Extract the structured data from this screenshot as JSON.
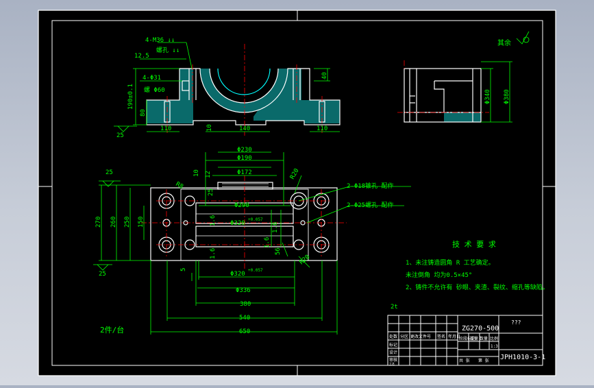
{
  "colors": {
    "outline": "#ffffff",
    "dimension": "#00ff00",
    "centerline": "#ff0000",
    "hatch": "#00ffff",
    "section": "#00ffff",
    "background": "#000000"
  },
  "top_view": {
    "callouts": [
      "4-M36 ↓↓",
      "螺孔 ↓↓",
      "4-Φ31",
      "螺 Φ60"
    ],
    "dims": {
      "d125": "12.5",
      "d190": "190±0.1",
      "d80": "80",
      "d40": "40",
      "d110_left": "110",
      "d10": "10",
      "d140": "140",
      "d110_right": "110",
      "rough25": "25"
    }
  },
  "side_view": {
    "dims": {
      "phi340": "Φ340",
      "phi380": "Φ380"
    },
    "finish_note": "其余"
  },
  "plan_view": {
    "dims": {
      "phi230": "Φ230",
      "phi190": "Φ190",
      "phi172": "Φ172",
      "d270": "270",
      "d260": "260",
      "d250": "250",
      "d150": "150",
      "d10": "10",
      "d12": "12",
      "d25": "25",
      "r20": "R20",
      "r8": "R8",
      "phi290": "Φ290",
      "phi320a": "Φ320",
      "tol_a": "+0.057",
      "phi320b": "Φ320",
      "tol_b": "+0.057",
      "phi336": "Φ336",
      "d380": "380",
      "d540": "540",
      "d650": "650",
      "d16a": "1.6",
      "d16b": "1.6",
      "d16c": "1.6",
      "d16d": "1.6",
      "d5": "5",
      "d56": "56",
      "rough25_left": "25",
      "rough25_bottom": "25"
    },
    "hole_callouts": [
      "2-Φ18锥孔 配作",
      "2-Φ25螺孔 配作"
    ],
    "scale_note": "2件/台"
  },
  "tech_req": {
    "heading": "技 术 要 求",
    "lines": [
      "1、未注铸造圆角 R 工艺确定。",
      "未注倒角 均为0.5×45°",
      "2、铸件不允许有 砂眼、夹渣、裂纹、缩孔等缺陷。"
    ],
    "note_2": "2t"
  },
  "title_block": {
    "material": "ZG270-500",
    "unknown": "???",
    "scale_label": "比例",
    "scale": "1:3",
    "quantity_label": "数量",
    "weight_label": "重量",
    "drawing_no": "JPH1010-3-1",
    "rows": [
      "标记",
      "设计",
      "审核",
      "工艺"
    ],
    "cells": [
      "处数",
      "分区",
      "更改文件号",
      "签名",
      "年月日",
      "阶段标记",
      "共  张",
      "第  张"
    ]
  }
}
